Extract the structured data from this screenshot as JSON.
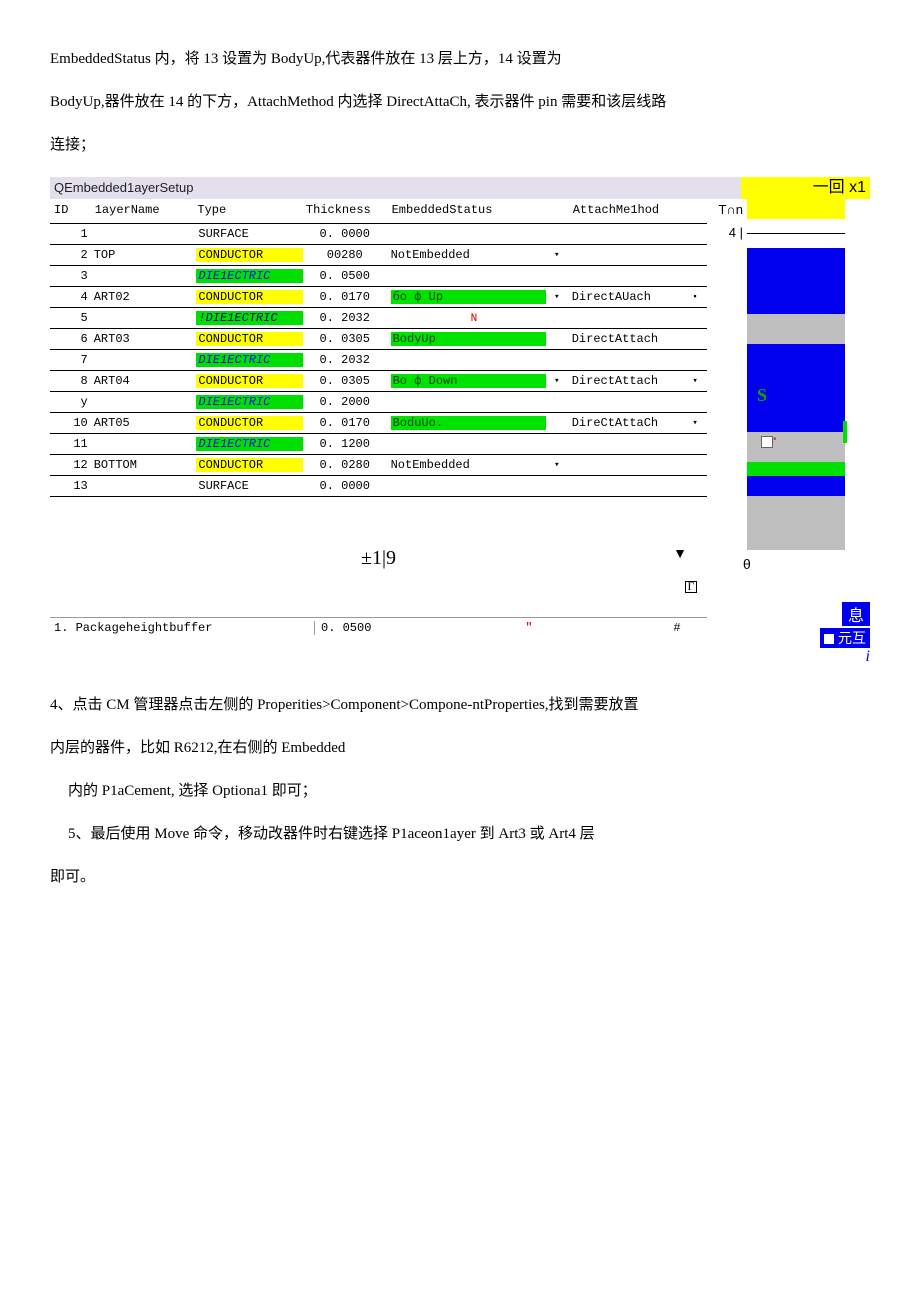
{
  "intro": {
    "p1": "EmbeddedStatus 内，将 13 设置为 BodyUp,代表器件放在 13 层上方，14 设置为",
    "p2": "BodyUp,器件放在 14 的下方，AttachMethod 内选择 DirectAttaCh, 表示器件 pin 需要和该层线路",
    "p3": "连接；"
  },
  "window": {
    "title": "QEmbedded1ayerSetup",
    "title_right": "一回 x1",
    "headers": {
      "id": "ID",
      "layerName": "1ayerName",
      "type": "Type",
      "thickness": "Thickness",
      "embeddedStatus": "EmbeddedStatus",
      "attachMethod": "AttachMe1hod"
    },
    "rows": [
      {
        "id": "1",
        "name": "",
        "type": "SURFACE",
        "typeClass": "",
        "thick": "0. 0000",
        "embed": "",
        "embedClass": "",
        "attach": "",
        "dd1": "",
        "dd2": ""
      },
      {
        "id": "2",
        "name": "TOP",
        "type": "CONDUCTOR",
        "typeClass": "yellow-bg",
        "thick": "00280",
        "embed": "NotEmbedded",
        "embedClass": "",
        "attach": "",
        "dd1": "▾",
        "dd2": ""
      },
      {
        "id": "3",
        "name": "",
        "type": "DIE1ECTRIC",
        "typeClass": "green-bg",
        "thick": "0. 0500",
        "embed": "",
        "embedClass": "",
        "attach": "",
        "dd1": "",
        "dd2": ""
      },
      {
        "id": "4",
        "name": "ART02",
        "type": "CONDUCTOR",
        "typeClass": "yellow-bg",
        "thick": "0. 0170",
        "embed": "бо ф Up",
        "embedClass": "embed-green",
        "attach": "DirectAUach",
        "dd1": "▾",
        "dd2": "▪"
      },
      {
        "id": "5",
        "name": "",
        "type": "!DIE1ECTRIC",
        "typeClass": "green-bg2",
        "thick": "0. 2032",
        "embed": "N",
        "embedClass": "red-n",
        "attach": "",
        "dd1": "",
        "dd2": ""
      },
      {
        "id": "6",
        "name": "ART03",
        "type": "CONDUCTOR",
        "typeClass": "yellow-bg",
        "thick": "0. 0305",
        "embed": "BodyUp",
        "embedClass": "embed-green",
        "attach": "DirectAttach",
        "dd1": "",
        "dd2": ""
      },
      {
        "id": "7",
        "name": "",
        "type": "DIE1ECTRIC",
        "typeClass": "green-bg",
        "thick": "0. 2032",
        "embed": "",
        "embedClass": "",
        "attach": "",
        "dd1": "",
        "dd2": ""
      },
      {
        "id": "8",
        "name": "ART04",
        "type": "CONDUCTOR",
        "typeClass": "yellow-bg",
        "thick": "0. 0305",
        "embed": "Bo ф Down",
        "embedClass": "embed-green",
        "attach": "DirectAttach",
        "dd1": "▾",
        "dd2": "▾"
      },
      {
        "id": "у",
        "name": "",
        "type": "DIE1ECTRIC",
        "typeClass": "green-bg",
        "thick": "0. 2000",
        "embed": "",
        "embedClass": "",
        "attach": "",
        "dd1": "",
        "dd2": ""
      },
      {
        "id": "10",
        "name": "ART05",
        "type": "CONDUCTOR",
        "typeClass": "yellow-bg",
        "thick": "0. 0170",
        "embed": "BoduUo.",
        "embedClass": "embed-green",
        "attach": "DireCtAttaCh",
        "dd1": "",
        "dd2": "▾"
      },
      {
        "id": "11",
        "name": "",
        "type": "DIE1ECTRIC",
        "typeClass": "green-bg",
        "thick": "0. 1200",
        "embed": "",
        "embedClass": "",
        "attach": "",
        "dd1": "",
        "dd2": ""
      },
      {
        "id": "12",
        "name": "BOTTOM",
        "type": "CONDUCTOR",
        "typeClass": "yellow-bg",
        "thick": "0. 0280",
        "embed": "NotEmbedded",
        "embedClass": "",
        "attach": "",
        "dd1": "▾",
        "dd2": ""
      },
      {
        "id": "13",
        "name": "",
        "type": "SURFACE",
        "typeClass": "",
        "thick": "0. 0000",
        "embed": "",
        "embedClass": "",
        "attach": "",
        "dd1": "",
        "dd2": ""
      }
    ],
    "below_text": "±1|9",
    "footer": {
      "label": "1. Packageheightbuffer",
      "value": "0. 0500",
      "quote": "\"",
      "hash": "#"
    },
    "preview": {
      "top_label": "T∩n",
      "n4": "4 |",
      "s": "S",
      "theta": "θ",
      "xi": "息",
      "yuanhu": "元互",
      "i": "i"
    }
  },
  "after": {
    "p4": "4、点击 CM 管理器点击左侧的 Properities>Component>Compone-ntProperties,找到需要放置",
    "p5": "内层的器件，比如 R6212,在右侧的 Embedded",
    "p6": "内的 P1aCement, 选择 Optiona1 即可；",
    "p7": "5、最后使用 Move 命令，移动改器件时右键选择 P1aceon1ayer 到 Art3 或 Art4 层",
    "p8": "即可。"
  }
}
